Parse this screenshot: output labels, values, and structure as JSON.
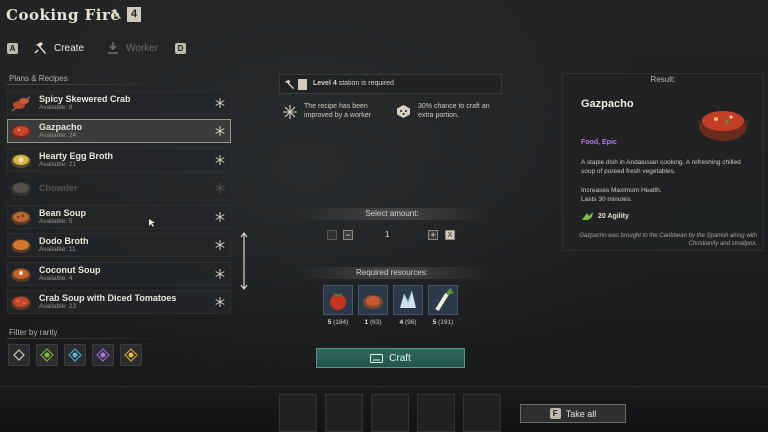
{
  "header": {
    "title": "Cooking Fire",
    "station_level": "4"
  },
  "tabs": [
    {
      "key": "A",
      "label": "Create",
      "state": "active"
    },
    {
      "key": "D",
      "label": "Worker",
      "state": "inactive"
    }
  ],
  "plans": {
    "heading": "Plans & Recipes",
    "recipes": [
      {
        "name": "Spicy Skewered Crab",
        "available": "Available: 8"
      },
      {
        "name": "Gazpacho",
        "available": "Available: 24",
        "selected": true
      },
      {
        "name": "Hearty Egg Broth",
        "available": "Available: 21"
      },
      {
        "name": "Chowder",
        "available": "",
        "disabled": true
      },
      {
        "name": "Bean Soup",
        "available": "Available: 5"
      },
      {
        "name": "Dodo Broth",
        "available": "Available: 11"
      },
      {
        "name": "Coconut Soup",
        "available": "Available: 4"
      },
      {
        "name": "Crab Soup with Diced Tomatoes",
        "available": "Available: 23"
      }
    ]
  },
  "filter": {
    "heading": "Filter by rarity"
  },
  "requirements": {
    "station_level": "Level 4",
    "station_suffix": "station is required",
    "bonus_worker": "The recipe has been improved by a worker",
    "bonus_extra": "30% chance to craft an extra portion."
  },
  "amount": {
    "heading": "Select amount:",
    "value": "1",
    "minus": "−",
    "plus": "+",
    "max_key": "X"
  },
  "resources": {
    "heading": "Required resources:",
    "items": [
      {
        "name": "tomato",
        "required": "5",
        "owned": "(184)"
      },
      {
        "name": "cooked-dish",
        "required": "1",
        "owned": "(63)"
      },
      {
        "name": "salt-crystal",
        "required": "4",
        "owned": "(96)"
      },
      {
        "name": "leek",
        "required": "5",
        "owned": "(191)"
      }
    ]
  },
  "craft": {
    "label": "Craft"
  },
  "result": {
    "heading": "Result:",
    "name": "Gazpacho",
    "type": "Food, Epic",
    "desc1": "A staple dish in Andalusian cooking. A refreshing chilled soup of pureed fresh vegetables.",
    "desc2": "Increases Maximum Health.",
    "desc3": "Lasts 30 minutes.",
    "stat": "20 Agility",
    "lore": "Gazpacho was brought to the Caribbean by the Spanish along with Christianity and smallpox."
  },
  "bottom": {
    "take_key": "F",
    "take_label": "Take all"
  },
  "colors": {
    "accent": "#2e6a5e",
    "epic": "#b178e6",
    "selected_border": "#9b9787"
  }
}
